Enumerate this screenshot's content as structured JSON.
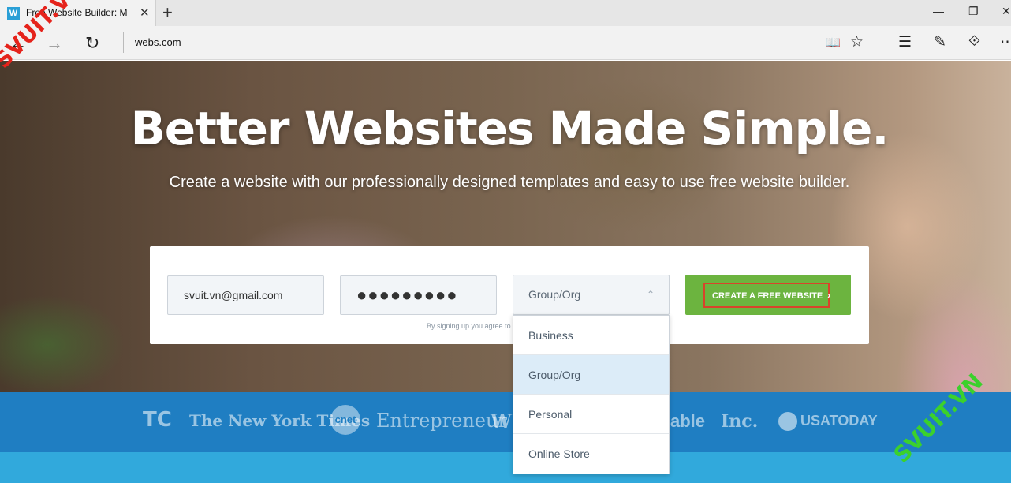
{
  "browser": {
    "tab_title": "Free Website Builder: M",
    "tab_favicon_letter": "W",
    "tab_close": "✕",
    "new_tab": "+",
    "window_minimize": "—",
    "window_maximize": "❐",
    "window_close": "✕",
    "back": "←",
    "forward": "→",
    "refresh": "↻",
    "url": "webs.com",
    "reading_view": "📖",
    "favorite": "☆",
    "hub": "☰",
    "notes": "✎",
    "share": "⟐",
    "more": "⋯"
  },
  "hero": {
    "headline": "Better Websites Made Simple.",
    "subheadline": "Create a website with our professionally designed templates and easy to use free website builder."
  },
  "signup": {
    "email_value": "svuit.vn@gmail.com",
    "password_value": "●●●●●●●●●",
    "category_selected": "Group/Org",
    "category_chevron": "⌃",
    "cta_label": "CREATE A FREE WEBSITE",
    "cta_arrow": "›",
    "terms_text": "By signing up you agree to"
  },
  "dropdown": {
    "options": [
      "Business",
      "Group/Org",
      "Personal",
      "Online Store"
    ],
    "selected_index": 1
  },
  "press": {
    "logos": [
      "TC",
      "The New York Times",
      "cnet",
      "Entrepreneur",
      "WS",
      "able",
      "Inc.",
      "USATODAY"
    ]
  },
  "watermark": {
    "text": "SVUIT.VN",
    "colors": [
      "#e5231b",
      "#3bd12c"
    ]
  },
  "colors": {
    "cta_green": "#6cb43f",
    "highlight_red": "#d9432b",
    "press_blue": "#1f7ec2",
    "band_blue": "#31a9dc",
    "dropdown_selected": "#dcecf8"
  }
}
